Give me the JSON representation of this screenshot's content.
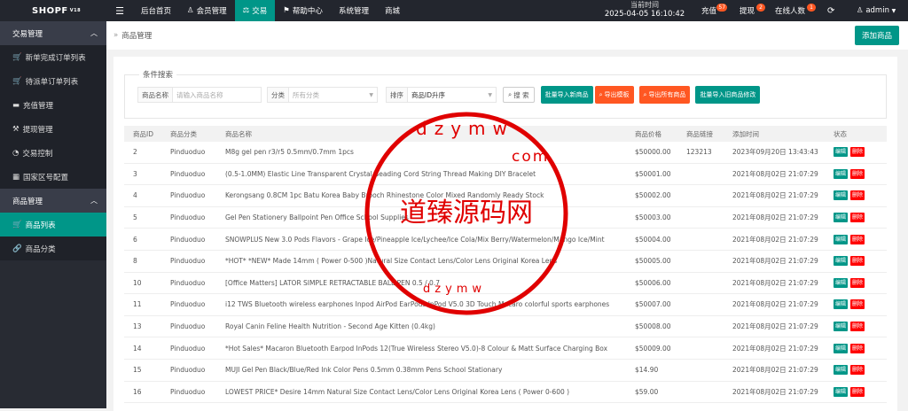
{
  "topbar": {
    "logo": "SHOPF",
    "version": "V18",
    "nav": [
      {
        "label": "后台首页",
        "icon": ""
      },
      {
        "label": "会员管理",
        "icon": "user"
      },
      {
        "label": "交易",
        "icon": "trade",
        "active": true
      },
      {
        "label": "帮助中心",
        "icon": "flag"
      },
      {
        "label": "系统管理",
        "icon": ""
      },
      {
        "label": "商城",
        "icon": ""
      }
    ],
    "clock_label": "当前时间",
    "clock_value": "2025-04-05 16:10:42",
    "recharge": "充值",
    "recharge_badge": "57",
    "withdraw": "提现",
    "withdraw_badge": "2",
    "online": "在线人数",
    "online_badge": "1",
    "user": "admin"
  },
  "sidebar": {
    "group1": "交易管理",
    "items1": [
      "新单完成订单列表",
      "待派单订单列表",
      "充值管理",
      "提现管理",
      "交易控制",
      "国家区号配置"
    ],
    "group2": "商品管理",
    "items2": [
      "商品列表",
      "商品分类"
    ]
  },
  "breadcrumb": "商品管理",
  "add_button": "添加商品",
  "filter": {
    "legend": "条件搜索",
    "name_label": "商品名称",
    "name_placeholder": "请输入商品名称",
    "category_label": "分类",
    "category_value": "所有分类",
    "sort_label": "排序",
    "sort_value": "商品ID升序",
    "search_button": "搜 索",
    "import_new": "批量导入新商品",
    "export_template": "导出模板",
    "export_all": "导出所有商品",
    "import_update": "批量导入旧商品修改"
  },
  "table": {
    "headers": [
      "商品ID",
      "商品分类",
      "商品名称",
      "商品价格",
      "商品链接",
      "添加时间",
      "状态"
    ],
    "edit_label": "编辑",
    "delete_label": "删除",
    "rows": [
      {
        "id": "2",
        "category": "Pinduoduo",
        "name": "M8g gel pen r3/r5 0.5mm/0.7mm 1pcs",
        "price": "$50000.00",
        "link": "123213",
        "time": "2023年09月20日 13:43:43"
      },
      {
        "id": "3",
        "category": "Pinduoduo",
        "name": "(0.5-1.0MM) Elastic Line Transparent Crystal Beading Cord String Thread Making DIY Bracelet",
        "price": "$50001.00",
        "link": "",
        "time": "2021年08月02日 21:07:29"
      },
      {
        "id": "4",
        "category": "Pinduoduo",
        "name": "Kerongsang 0.8CM 1pc Batu Korea Baby Brooch Rhinestone Color Mixed Randomly Ready Stock",
        "price": "$50002.00",
        "link": "",
        "time": "2021年08月02日 21:07:29"
      },
      {
        "id": "5",
        "category": "Pinduoduo",
        "name": "Gel Pen Stationery Ballpoint Pen Office School Supplies",
        "price": "$50003.00",
        "link": "",
        "time": "2021年08月02日 21:07:29"
      },
      {
        "id": "6",
        "category": "Pinduoduo",
        "name": "SNOWPLUS New 3.0 Pods Flavors - Grape Ice/Pineapple Ice/Lychee/Ice Cola/Mix Berry/Watermelon/Mango Ice/Mint",
        "price": "$50004.00",
        "link": "",
        "time": "2021年08月02日 21:07:29"
      },
      {
        "id": "8",
        "category": "Pinduoduo",
        "name": "*HOT* *NEW* Made 14mm ( Power 0-500 )Natural Size Contact Lens/Color Lens Original Korea Lens",
        "price": "$50005.00",
        "link": "",
        "time": "2021年08月02日 21:07:29"
      },
      {
        "id": "10",
        "category": "Pinduoduo",
        "name": "[Office Matters] LATOR SIMPLE RETRACTABLE BALL PEN 0.5 / 0.7",
        "price": "$50006.00",
        "link": "",
        "time": "2021年08月02日 21:07:29"
      },
      {
        "id": "11",
        "category": "Pinduoduo",
        "name": "i12 TWS Bluetooth wireless earphones Inpod AirPod EarPods InPod V5.0 3D Touch Macaro colorful sports earphones",
        "price": "$50007.00",
        "link": "",
        "time": "2021年08月02日 21:07:29"
      },
      {
        "id": "13",
        "category": "Pinduoduo",
        "name": "Royal Canin Feline Health Nutrition - Second Age Kitten (0.4kg)",
        "price": "$50008.00",
        "link": "",
        "time": "2021年08月02日 21:07:29"
      },
      {
        "id": "14",
        "category": "Pinduoduo",
        "name": "*Hot Sales* Macaron Bluetooth Earpod InPods 12(True Wireless Stereo V5.0)-8 Colour & Matt Surface Charging Box",
        "price": "$50009.00",
        "link": "",
        "time": "2021年08月02日 21:07:29"
      },
      {
        "id": "15",
        "category": "Pinduoduo",
        "name": "MUJI Gel Pen Black/Blue/Red Ink Color Pens 0.5mm 0.38mm Pens School Stationary",
        "price": "$14.90",
        "link": "",
        "time": "2021年08月02日 21:07:29"
      },
      {
        "id": "16",
        "category": "Pinduoduo",
        "name": "LOWEST PRICE* Desire 14mm Natural Size Contact Lens/Color Lens Original Korea Lens ( Power 0-600 )",
        "price": "$59.00",
        "link": "",
        "time": "2021年08月02日 21:07:29"
      }
    ]
  },
  "watermark": {
    "text": "道臻源码网",
    "ring_top": "dzymw",
    "ring_com": "com",
    "color": "#e00000"
  },
  "colors": {
    "accent": "#009688",
    "orange": "#ff5722",
    "danger": "#ff0000",
    "topbar": "#23262e",
    "sidebar": "#282b33"
  }
}
